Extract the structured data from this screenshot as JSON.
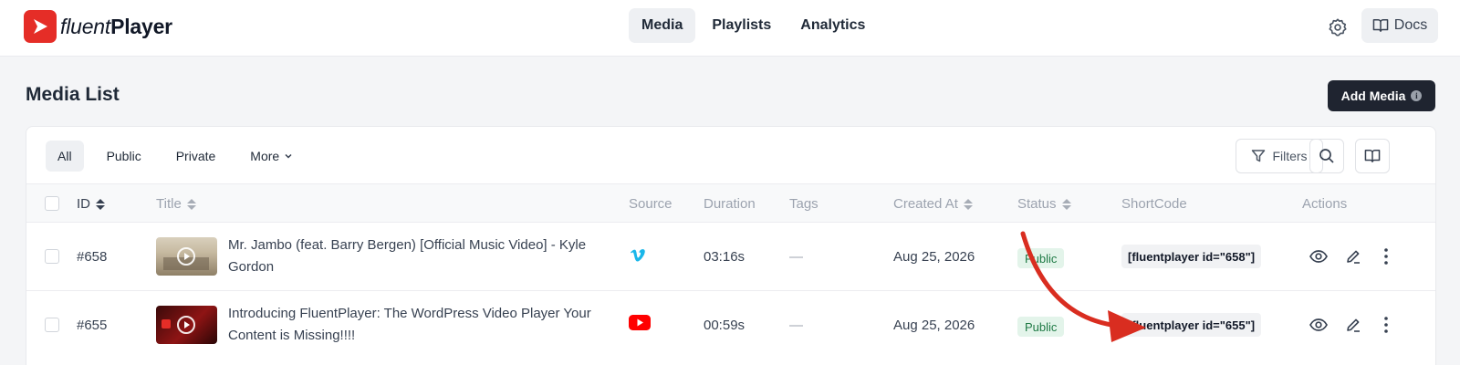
{
  "app": {
    "logo_prefix": "fluent",
    "logo_suffix": "Player",
    "brand_color": "#e52d27"
  },
  "topnav": [
    {
      "label": "Media",
      "active": true
    },
    {
      "label": "Playlists",
      "active": false
    },
    {
      "label": "Analytics",
      "active": false
    }
  ],
  "header": {
    "docs_label": "Docs",
    "page_title": "Media List",
    "add_media_label": "Add Media"
  },
  "tabs": [
    {
      "label": "All",
      "active": true
    },
    {
      "label": "Public",
      "active": false
    },
    {
      "label": "Private",
      "active": false
    },
    {
      "label": "More",
      "active": false
    }
  ],
  "toolbar": {
    "filters_label": "Filters"
  },
  "table": {
    "columns": [
      "ID",
      "Title",
      "Source",
      "Duration",
      "Tags",
      "Created At",
      "Status",
      "ShortCode",
      "Actions"
    ],
    "rows": [
      {
        "id": "#658",
        "title": "Mr. Jambo (feat. Barry Bergen) [Official Music Video] - Kyle Gordon",
        "source": "vimeo-icon",
        "duration": "03:16s",
        "tags": "—",
        "created_at": "Aug 25, 2026",
        "status": "Public",
        "shortcode": "[fluentplayer id=\"658\"]"
      },
      {
        "id": "#655",
        "title": "Introducing FluentPlayer: The WordPress Video Player Your Content is Missing!!!!",
        "source": "youtube-icon",
        "duration": "00:59s",
        "tags": "—",
        "created_at": "Aug 25, 2026",
        "status": "Public",
        "shortcode": "[fluentplayer id=\"655\"]"
      }
    ]
  }
}
